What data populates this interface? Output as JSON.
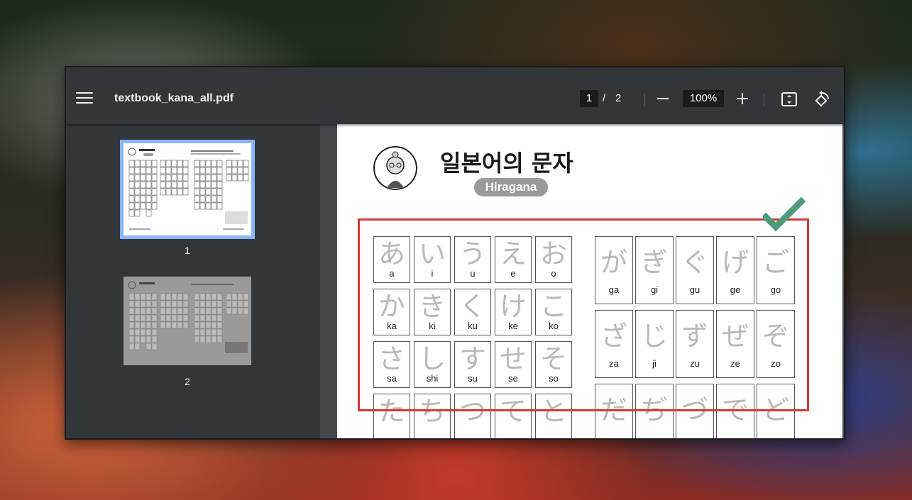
{
  "window": {
    "file_name": "textbook_kana_all.pdf",
    "current_page": "1",
    "page_separator": "/",
    "total_pages": "2",
    "zoom": "100%"
  },
  "icons": {
    "menu": "hamburger-menu-icon",
    "zoom_out": "minus-icon",
    "zoom_in": "plus-icon",
    "fit": "fit-page-icon",
    "rotate": "rotate-icon"
  },
  "thumbnails": [
    {
      "label": "1",
      "selected": true
    },
    {
      "label": "2",
      "selected": false
    }
  ],
  "document": {
    "title": "일본어의 문자",
    "badge": "Hiragana",
    "left_grid": [
      [
        {
          "k": "あ",
          "r": "a"
        },
        {
          "k": "い",
          "r": "i"
        },
        {
          "k": "う",
          "r": "u"
        },
        {
          "k": "え",
          "r": "e"
        },
        {
          "k": "お",
          "r": "o"
        }
      ],
      [
        {
          "k": "か",
          "r": "ka"
        },
        {
          "k": "き",
          "r": "ki"
        },
        {
          "k": "く",
          "r": "ku"
        },
        {
          "k": "け",
          "r": "ke"
        },
        {
          "k": "こ",
          "r": "ko"
        }
      ],
      [
        {
          "k": "さ",
          "r": "sa"
        },
        {
          "k": "し",
          "r": "shi"
        },
        {
          "k": "す",
          "r": "su"
        },
        {
          "k": "せ",
          "r": "se"
        },
        {
          "k": "そ",
          "r": "so"
        }
      ],
      [
        {
          "k": "た",
          "r": ""
        },
        {
          "k": "ち",
          "r": ""
        },
        {
          "k": "つ",
          "r": ""
        },
        {
          "k": "て",
          "r": ""
        },
        {
          "k": "と",
          "r": ""
        }
      ]
    ],
    "right_grid": [
      [
        {
          "k": "が",
          "r": "ga"
        },
        {
          "k": "ぎ",
          "r": "gi"
        },
        {
          "k": "ぐ",
          "r": "gu"
        },
        {
          "k": "げ",
          "r": "ge"
        },
        {
          "k": "ご",
          "r": "go"
        }
      ],
      [
        {
          "k": "ざ",
          "r": "za"
        },
        {
          "k": "じ",
          "r": "ji"
        },
        {
          "k": "ず",
          "r": "zu"
        },
        {
          "k": "ぜ",
          "r": "ze"
        },
        {
          "k": "ぞ",
          "r": "zo"
        }
      ],
      [
        {
          "k": "だ",
          "r": ""
        },
        {
          "k": "ぢ",
          "r": ""
        },
        {
          "k": "づ",
          "r": ""
        },
        {
          "k": "で",
          "r": ""
        },
        {
          "k": "ど",
          "r": ""
        }
      ]
    ]
  },
  "colors": {
    "highlight": "#d23a36",
    "check": "#4e9a7b",
    "selected_thumb": "#8ab4f8"
  }
}
